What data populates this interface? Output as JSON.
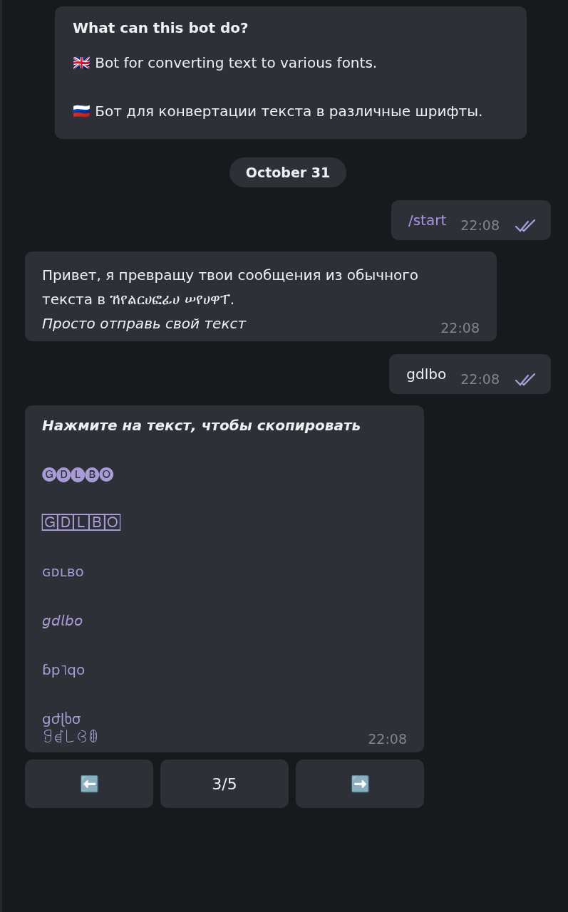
{
  "intro": {
    "title": "What can this bot do?",
    "paragraphs": [
      "🇬🇧 Bot for converting text to various fonts.",
      "🇷🇺 Бот для конвертации текста в различные шрифты."
    ]
  },
  "date_chip": "October 31",
  "messages": [
    {
      "kind": "outgoing",
      "text": "/start",
      "command": true,
      "time": "22:08",
      "read": true
    },
    {
      "kind": "incoming",
      "paragraphs": [
        "Привет, я превращу твои сообщения из обычного текста в ኸየልርሀፎፊሀ ሠየሀዋፐ.",
        "*Просто отправь свой текст*"
      ],
      "time": "22:08"
    },
    {
      "kind": "outgoing",
      "text": "gdlbo",
      "command": false,
      "time": "22:08",
      "read": true
    },
    {
      "kind": "variants",
      "heading": "Нажмите на текст, чтобы скопировать",
      "lines": [
        "🅖🅓🅛🅑🅞",
        "🄶🄳🄻🄱🄾",
        "ɢᴅʟʙᴏ",
        "𝘨𝘥𝘭𝘣𝘰",
        "ɓp˥qo",
        "ցժɭხσ",
        "ꍌꀸ꒒ꃳꂦ"
      ],
      "time": "22:08"
    }
  ],
  "keyboard": [
    "⬅️",
    "3/5",
    "➡️"
  ]
}
